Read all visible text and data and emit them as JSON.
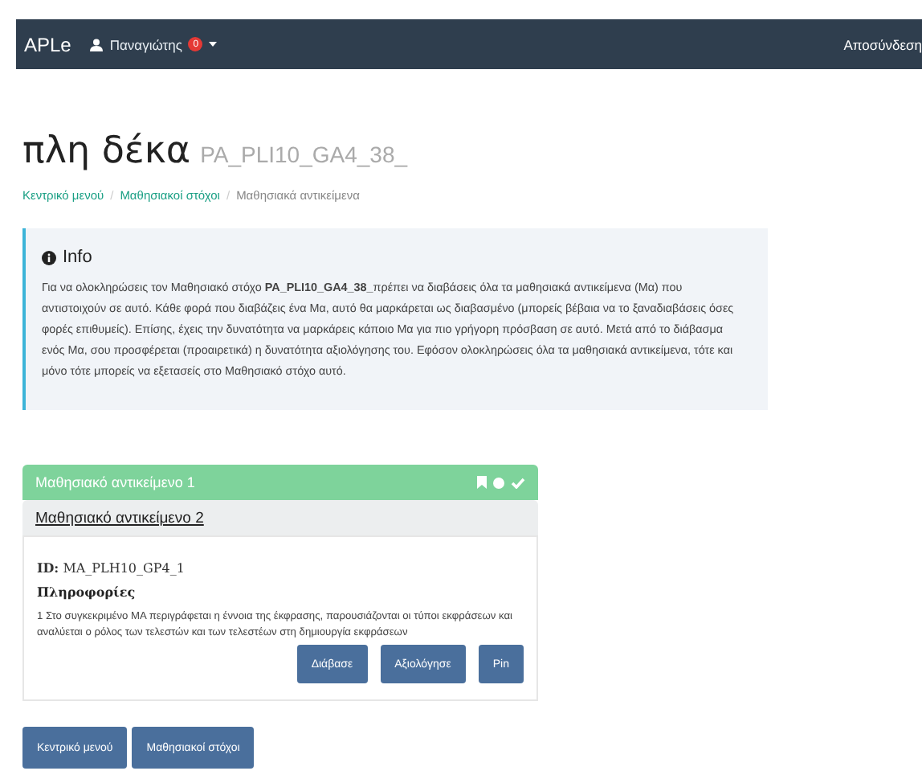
{
  "navbar": {
    "brand": "APLe",
    "user": "Παναγιώτης",
    "badge": "0",
    "logout": "Αποσύνδεση"
  },
  "title": "πλη δέκα",
  "subtitle": "PA_PLI10_GA4_38_",
  "breadcrumb_separator": "/",
  "breadcrumb": [
    {
      "label": "Κεντρικό μενού",
      "link": true
    },
    {
      "label": "Μαθησιακοί στόχοι",
      "link": true
    },
    {
      "label": "Μαθησιακά αντικείμενα",
      "link": false
    }
  ],
  "info": {
    "heading": "Info",
    "text": "Για να ολοκληρώσεις τον Μαθησιακό στόχο **PA_PLI10_GA4_38_**πρέπει να διαβάσεις όλα τα μαθησιακά αντικείμενα (Μα) που αντιστοιχούν σε αυτό. Κάθε φορά που διαβάζεις ένα Μα, αυτό θα μαρκάρεται ως διαβασμένο (μπορείς βέβαια να το ξαναδιαβάσεις όσες φορές επιθυμείς). Επίσης, έχεις την δυνατότητα να μαρκάρεις κάποιο Μα για πιο γρήγορη πρόσβαση σε αυτό. Μετά από το διάβασμα ενός Μα, σου προσφέρεται (προαιρετικά) η δυνατότητα αξιολόγησης του. Εφόσον ολοκληρώσεις όλα τα μαθησιακά αντικείμενα, τότε και μόνο τότε μπορείς να εξετασείς στο Μαθησιακό στόχο αυτό."
  },
  "objects": [
    {
      "title": "Μαθησιακό αντικείμενο 1",
      "completed": true,
      "expanded": false
    },
    {
      "title": "Μαθησιακό αντικείμενο 2",
      "completed": false,
      "expanded": true,
      "id_label": "ID:",
      "id": "MA_PLH10_GP4_1",
      "info_heading": "Πληροφορίες",
      "description": "1 Στο συγκεκριμένο ΜΑ περιγράφεται η έννοια της έκφρασης, παρουσιάζονται οι τύποι εκφράσεων και αναλύεται ο ρόλος των τελεστών και των τελεστέων στη δημιουργία εκφράσεων",
      "actions": [
        "Διάβασε",
        "Αξιολόγησε",
        "Pin"
      ]
    }
  ],
  "footer_buttons": [
    "Κεντρικό μενού",
    "Μαθησιακοί στόχοι"
  ]
}
